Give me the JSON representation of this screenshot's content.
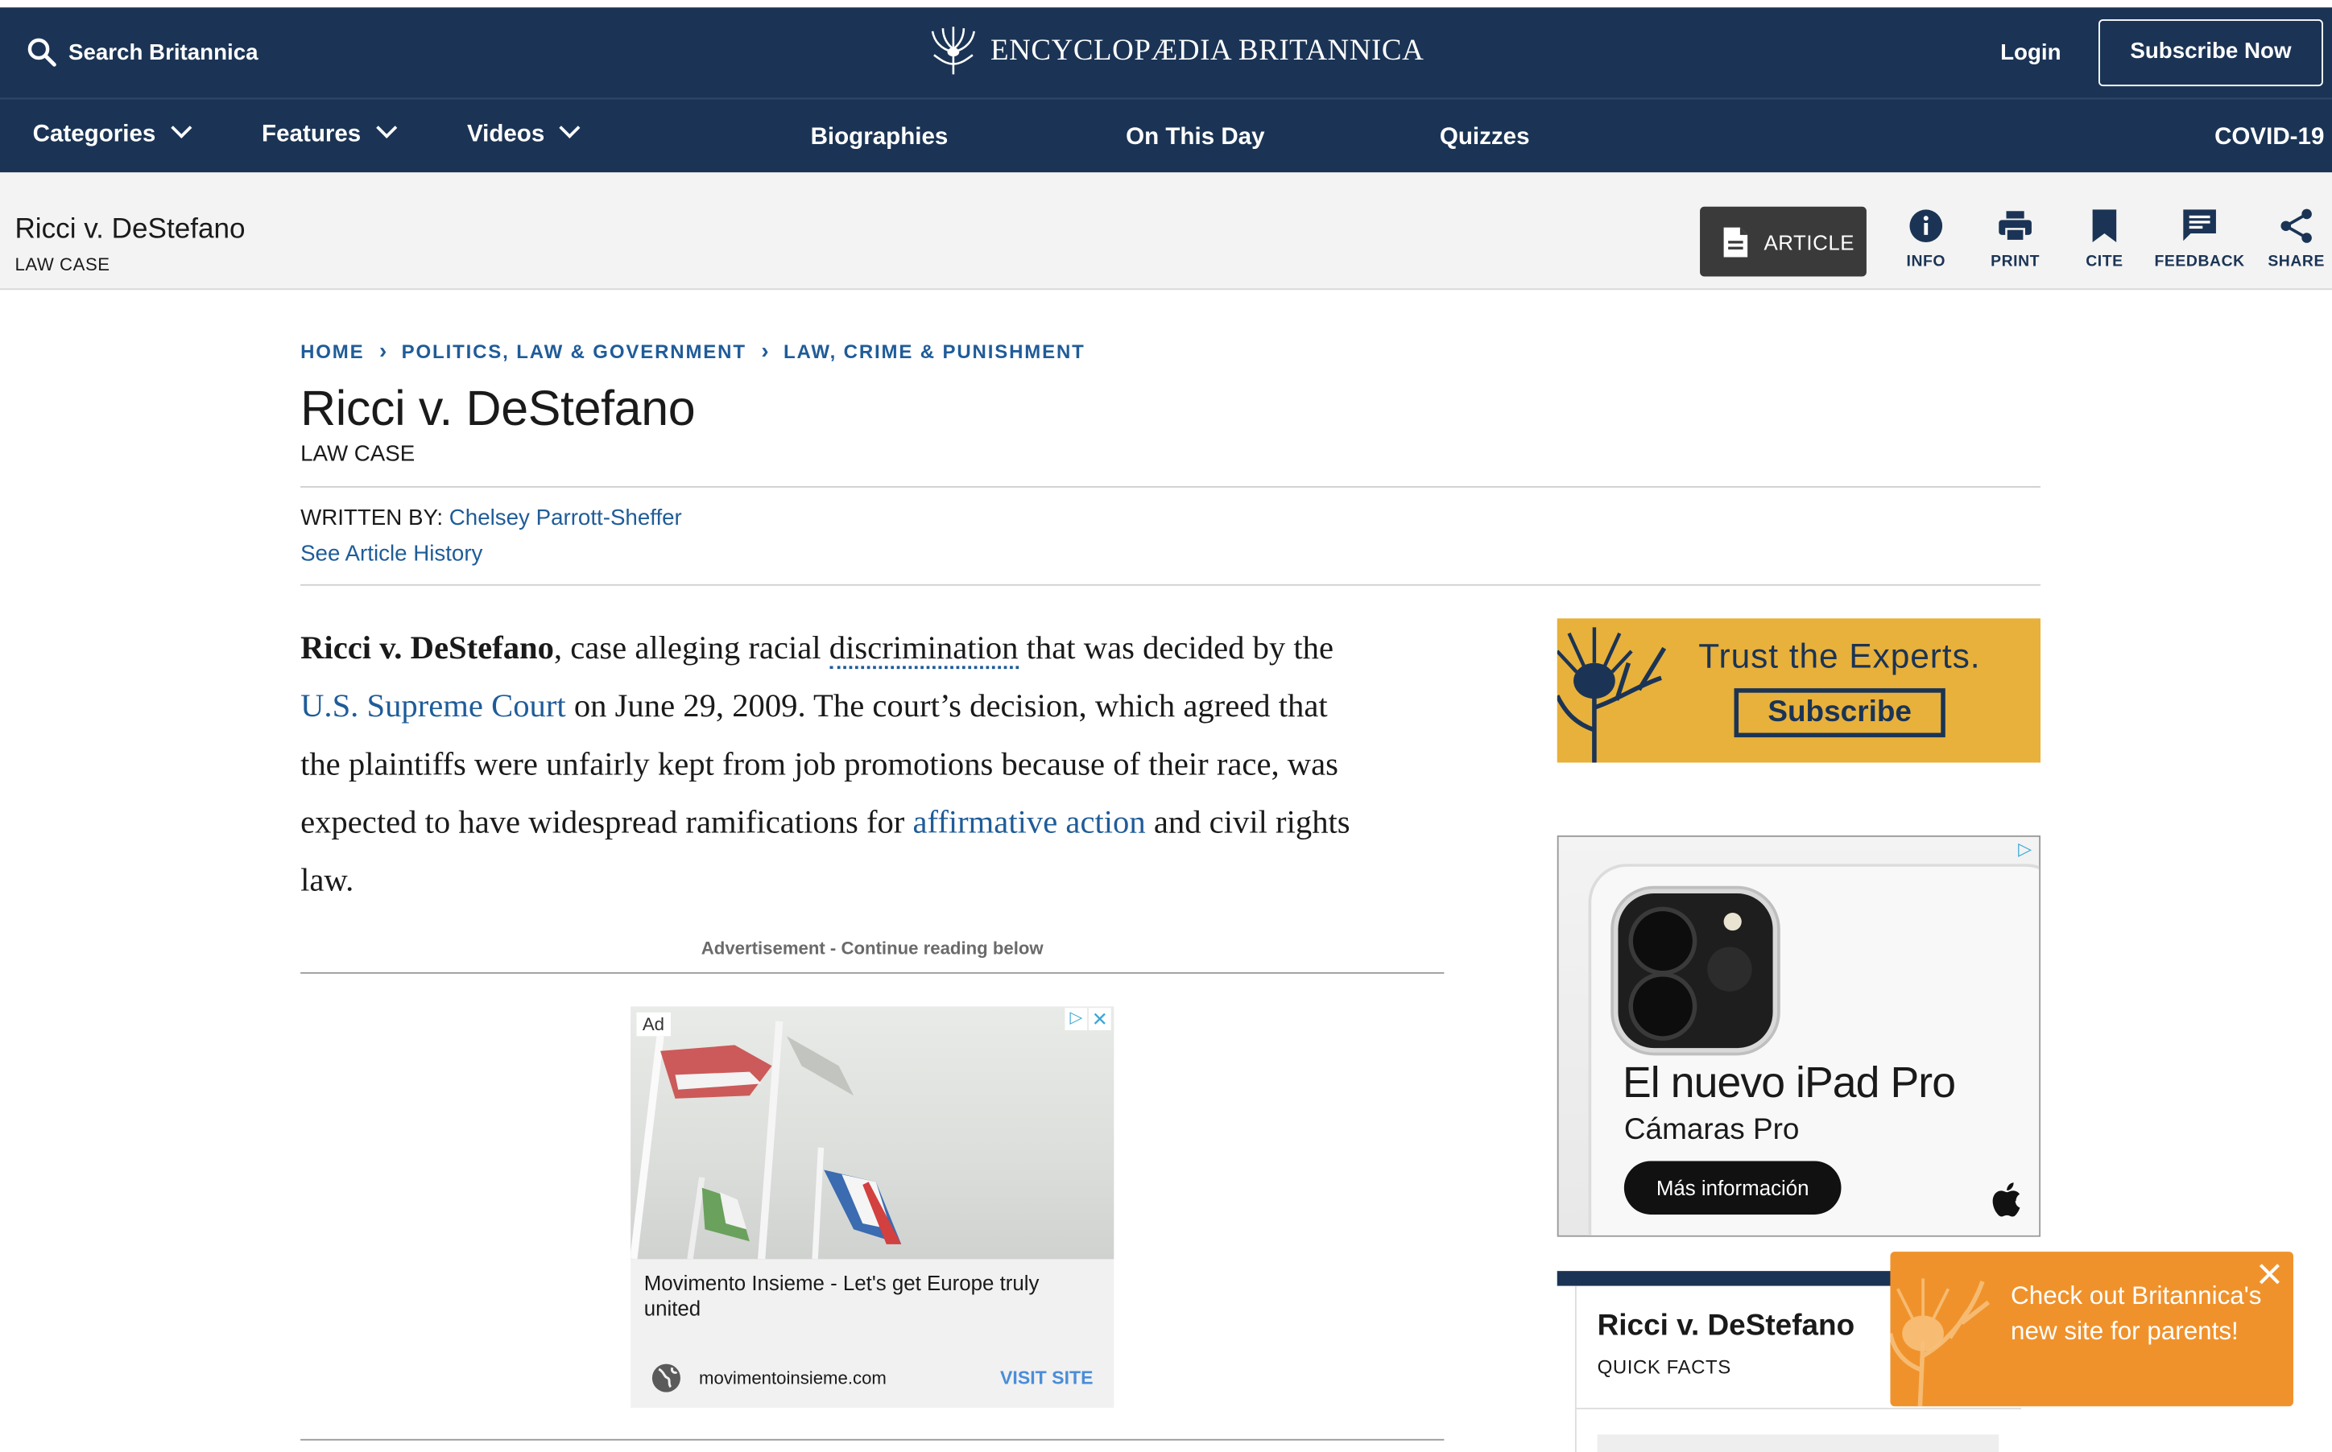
{
  "header": {
    "search_label": "Search Britannica",
    "logo_text": "ENCYCLOPÆDIA BRITANNICA",
    "login_label": "Login",
    "subscribe_label": "Subscribe Now"
  },
  "nav": {
    "categories": "Categories",
    "features": "Features",
    "videos": "Videos",
    "biographies": "Biographies",
    "on_this_day": "On This Day",
    "quizzes": "Quizzes",
    "covid": "COVID-19"
  },
  "subheader": {
    "title": "Ricci v. DeStefano",
    "subtitle": "LAW CASE",
    "article_button": "ARTICLE",
    "tools": {
      "info": "INFO",
      "print": "PRINT",
      "cite": "CITE",
      "feedback": "FEEDBACK",
      "share": "SHARE"
    }
  },
  "breadcrumb": {
    "home": "HOME",
    "level1": "POLITICS, LAW & GOVERNMENT",
    "level2": "LAW, CRIME & PUNISHMENT",
    "separator": "›"
  },
  "article": {
    "title": "Ricci v. DeStefano",
    "type": "LAW CASE",
    "written_by_label": "WRITTEN BY:",
    "author": "Chelsey Parrott-Sheffer",
    "history_link": "See Article History",
    "intro": {
      "bold": "Ricci v. DeStefano",
      "t1": ", case alleging racial ",
      "link_discrimination": "discrimination",
      "t2": " that was decided by the",
      "link_court": "U.S. Supreme Court",
      "t3": " on June 29, 2009. The court’s decision, which agreed that",
      "t4": "the plaintiffs were unfairly kept from job promotions because of their race, was",
      "t5": "expected to have widespread ramifications for ",
      "link_affirmative": "affirmative action",
      "t6": " and civil rights",
      "t7": "law."
    },
    "ad_notice": "Advertisement - Continue reading below"
  },
  "inline_ad": {
    "badge": "Ad",
    "headline": "Movimento Insieme - Let's get Europe truly united",
    "domain": "movimentoinsieme.com",
    "cta": "VISIT SITE"
  },
  "side_banner": {
    "tagline": "Trust the Experts.",
    "button": "Subscribe",
    "bg_color": "#e8b13b"
  },
  "ipad_ad": {
    "title": "El nuevo iPad Pro",
    "subtitle": "Cámaras Pro",
    "button": "Más información"
  },
  "quick_facts": {
    "title": "Ricci v. DeStefano",
    "label": "QUICK FACTS"
  },
  "popup": {
    "text": "Check out Britannica's new site for parents!",
    "bg_color": "#f0922b"
  }
}
